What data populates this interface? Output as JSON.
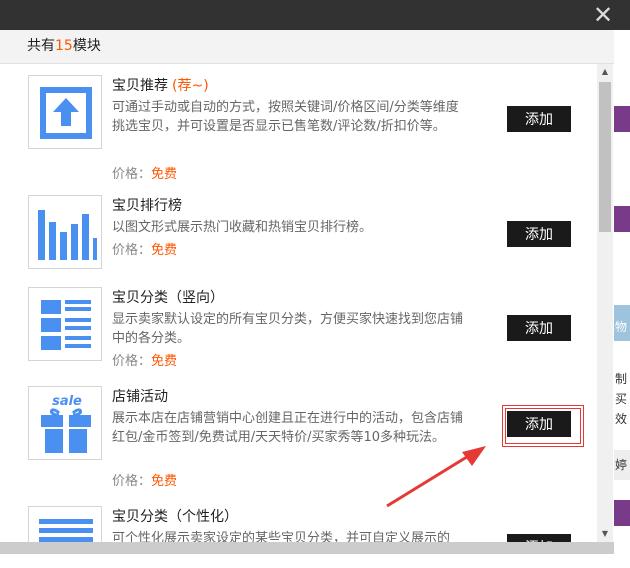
{
  "window": {
    "close_glyph": "✕"
  },
  "dialog": {
    "header_prefix": "共有",
    "module_count": "15",
    "header_suffix": "模块"
  },
  "items": [
    {
      "title": "宝贝推荐",
      "badge": "(荐~)",
      "desc": "可通过手动或自动的方式，按照关键词/价格区间/分类等维度挑选宝贝，并可设置是否显示已售笔数/评论数/折扣价等。",
      "price_label": "价格：",
      "price_value": "免费",
      "button": "添加",
      "icon": "upload-arrow-icon"
    },
    {
      "title": "宝贝排行榜",
      "badge": "",
      "desc": "以图文形式展示热门收藏和热销宝贝排行榜。",
      "price_label": "价格：",
      "price_value": "免费",
      "button": "添加",
      "icon": "bar-chart-icon"
    },
    {
      "title": "宝贝分类（竖向）",
      "badge": "",
      "desc": "显示卖家默认设定的所有宝贝分类，方便买家快速找到您店铺中的各分类。",
      "price_label": "价格：",
      "price_value": "免费",
      "button": "添加",
      "icon": "category-list-icon"
    },
    {
      "title": "店铺活动",
      "badge": "",
      "desc": "展示本店在店铺营销中心创建且正在进行中的活动，包含店铺红包/金币签到/免费试用/天天特价/买家秀等10多种玩法。",
      "price_label": "价格：",
      "price_value": "免费",
      "button": "添加",
      "icon": "sale-gift-icon",
      "icon_text": "sale"
    },
    {
      "title": "宝贝分类（个性化）",
      "badge": "",
      "desc": "可个性化展示卖家设定的某些宝贝分类，并可自定义展示的",
      "button": "添加",
      "icon": "horizontal-list-icon"
    }
  ],
  "background_fragments": [
    "物",
    "制",
    "买",
    "效",
    "婷"
  ],
  "colors": {
    "accent": "#ff5500",
    "icon_blue": "#4a90f0",
    "button_bg": "#1a1a1a",
    "highlight": "#e53935"
  }
}
